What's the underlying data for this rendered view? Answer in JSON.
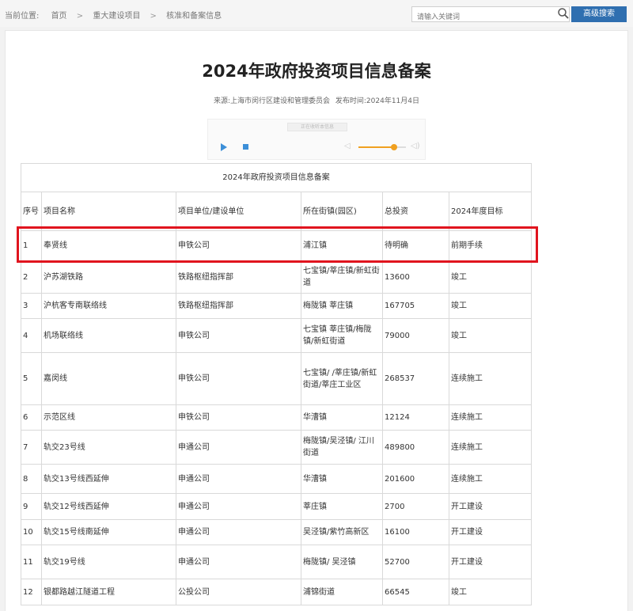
{
  "breadcrumb": {
    "label": "当前位置:",
    "items": [
      "首页",
      "重大建设项目",
      "核准和备案信息"
    ],
    "separator": ">"
  },
  "search": {
    "placeholder": "请输入关键词",
    "advanced_label": "高级搜索"
  },
  "article": {
    "title": "2024年政府投资项目信息备案",
    "source": "来源:上海市闵行区建设和管理委员会",
    "publish_time": "发布时间:2024年11月4日"
  },
  "player": {
    "title": "正在收听本信息",
    "volume": 0.75
  },
  "table": {
    "caption": "2024年政府投资项目信息备案",
    "headers": [
      "序号",
      "项目名称",
      "项目单位/建设单位",
      "所在街镇(园区)",
      "总投资",
      "2024年度目标"
    ],
    "rows": [
      [
        "1",
        "奉贤线",
        "申铁公司",
        "浦江镇",
        "待明确",
        "前期手续"
      ],
      [
        "2",
        "沪苏湖铁路",
        "铁路枢纽指挥部",
        "七宝镇/莘庄镇/新虹街道",
        "13600",
        "竣工"
      ],
      [
        "3",
        "沪杭客专南联络线",
        "铁路枢纽指挥部",
        "梅陇镇 莘庄镇",
        "167705",
        "竣工"
      ],
      [
        "4",
        "机场联络线",
        "申铁公司",
        "七宝镇 莘庄镇/梅陇镇/新虹街道",
        "79000",
        "竣工"
      ],
      [
        "5",
        "嘉闵线",
        "申铁公司",
        "七宝镇/ /莘庄镇/新虹街道/莘庄工业区",
        "268537",
        "连续施工"
      ],
      [
        "6",
        "示范区线",
        "申铁公司",
        "华漕镇",
        "12124",
        "连续施工"
      ],
      [
        "7",
        "轨交23号线",
        "申通公司",
        "梅陇镇/吴泾镇/ 江川街道",
        "489800",
        "连续施工"
      ],
      [
        "8",
        "轨交13号线西延伸",
        "申通公司",
        "华漕镇",
        "201600",
        "连续施工"
      ],
      [
        "9",
        "轨交12号线西延伸",
        "申通公司",
        "莘庄镇",
        "2700",
        "开工建设"
      ],
      [
        "10",
        "轨交15号线南延伸",
        "申通公司",
        "吴泾镇/紫竹高新区",
        "16100",
        "开工建设"
      ],
      [
        "11",
        "轨交19号线",
        "申通公司",
        "梅陇镇/ 吴泾镇",
        "52700",
        "开工建设"
      ],
      [
        "12",
        "银都路越江隧道工程",
        "公投公司",
        "浦锦街道",
        "66545",
        "竣工"
      ]
    ],
    "row_heights": [],
    "highlighted_row": 1
  },
  "colors": {
    "accent": "#2f6fb0",
    "highlight_border": "#e0141e",
    "player_accent": "#3c8fd8",
    "volume": "#f0a020"
  }
}
